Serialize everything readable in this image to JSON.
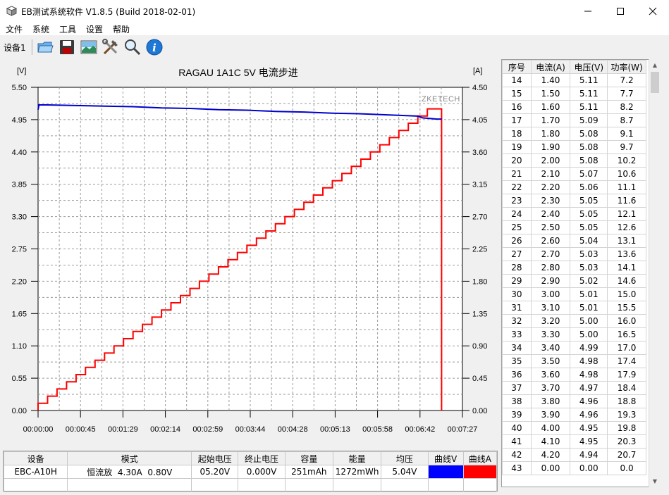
{
  "window": {
    "title": "EB测试系统软件 V1.8.5 (Build 2018-02-01)",
    "minimize_icon": "minimize-icon",
    "maximize_icon": "maximize-icon",
    "close_icon": "close-icon"
  },
  "menu": {
    "items": [
      "文件",
      "系统",
      "工具",
      "设置",
      "帮助"
    ]
  },
  "toolbar": {
    "device_tab": "设备1",
    "buttons": [
      "folder-open-icon",
      "save-icon",
      "chart-image-icon",
      "tools-icon",
      "zoom-icon",
      "info-icon"
    ]
  },
  "chart": {
    "brand": "ZKETECH",
    "colors": {
      "voltage": "#0000cc",
      "current": "#ff0000"
    }
  },
  "chart_data": {
    "type": "line",
    "title": "RAGAU 1A1C 5V 电流步进",
    "ylabel_left": "[V]",
    "ylabel_right": "[A]",
    "left_ticks": [
      "5.50",
      "4.95",
      "4.40",
      "3.85",
      "3.30",
      "2.75",
      "2.20",
      "1.65",
      "1.10",
      "0.55",
      "0.00"
    ],
    "right_ticks": [
      "4.50",
      "4.05",
      "3.60",
      "3.15",
      "2.70",
      "2.25",
      "1.80",
      "1.35",
      "0.90",
      "0.45",
      "0.00"
    ],
    "x_ticks": [
      "00:00:00",
      "00:00:45",
      "00:01:29",
      "00:02:14",
      "00:02:59",
      "00:03:44",
      "00:04:28",
      "00:05:13",
      "00:05:58",
      "00:06:42",
      "00:07:27"
    ],
    "ylim_left": [
      0,
      5.5
    ],
    "ylim_right": [
      0,
      4.5
    ],
    "xlim_seconds": [
      0,
      447
    ],
    "grid": true,
    "series": [
      {
        "name": "曲线V",
        "axis": "left",
        "x": [
          0,
          1,
          10,
          40,
          70,
          100,
          130,
          160,
          190,
          220,
          250,
          280,
          310,
          340,
          370,
          400,
          405,
          420,
          425
        ],
        "y": [
          5.12,
          5.2,
          5.2,
          5.19,
          5.18,
          5.17,
          5.15,
          5.14,
          5.12,
          5.11,
          5.09,
          5.08,
          5.06,
          5.05,
          5.03,
          5.01,
          4.98,
          4.96,
          4.96
        ]
      },
      {
        "name": "曲线A",
        "axis": "right",
        "steps_start": 0.1,
        "steps_increment": 0.1,
        "steps_count": 42,
        "step_seconds": 10,
        "end_seconds": 425
      }
    ]
  },
  "summary_table": {
    "headers": [
      "设备",
      "模式",
      "起始电压",
      "终止电压",
      "容量",
      "能量",
      "均压",
      "曲线V",
      "曲线A"
    ],
    "row": [
      "EBC-A10H",
      "恒流放  4.30A  0.80V",
      "05.20V",
      "0.000V",
      "251mAh",
      "1272mWh",
      "5.04V",
      "",
      ""
    ],
    "color_v": "#0000ff",
    "color_a": "#ff0000"
  },
  "step_table": {
    "headers": [
      "序号",
      "电流(A)",
      "电压(V)",
      "功率(W)"
    ],
    "rows": [
      [
        "14",
        "1.40",
        "5.11",
        "7.2"
      ],
      [
        "15",
        "1.50",
        "5.11",
        "7.7"
      ],
      [
        "16",
        "1.60",
        "5.11",
        "8.2"
      ],
      [
        "17",
        "1.70",
        "5.09",
        "8.7"
      ],
      [
        "18",
        "1.80",
        "5.08",
        "9.1"
      ],
      [
        "19",
        "1.90",
        "5.08",
        "9.7"
      ],
      [
        "20",
        "2.00",
        "5.08",
        "10.2"
      ],
      [
        "21",
        "2.10",
        "5.07",
        "10.6"
      ],
      [
        "22",
        "2.20",
        "5.06",
        "11.1"
      ],
      [
        "23",
        "2.30",
        "5.05",
        "11.6"
      ],
      [
        "24",
        "2.40",
        "5.05",
        "12.1"
      ],
      [
        "25",
        "2.50",
        "5.05",
        "12.6"
      ],
      [
        "26",
        "2.60",
        "5.04",
        "13.1"
      ],
      [
        "27",
        "2.70",
        "5.03",
        "13.6"
      ],
      [
        "28",
        "2.80",
        "5.03",
        "14.1"
      ],
      [
        "29",
        "2.90",
        "5.02",
        "14.6"
      ],
      [
        "30",
        "3.00",
        "5.01",
        "15.0"
      ],
      [
        "31",
        "3.10",
        "5.01",
        "15.5"
      ],
      [
        "32",
        "3.20",
        "5.00",
        "16.0"
      ],
      [
        "33",
        "3.30",
        "5.00",
        "16.5"
      ],
      [
        "34",
        "3.40",
        "4.99",
        "17.0"
      ],
      [
        "35",
        "3.50",
        "4.98",
        "17.4"
      ],
      [
        "36",
        "3.60",
        "4.98",
        "17.9"
      ],
      [
        "37",
        "3.70",
        "4.97",
        "18.4"
      ],
      [
        "38",
        "3.80",
        "4.96",
        "18.8"
      ],
      [
        "39",
        "3.90",
        "4.96",
        "19.3"
      ],
      [
        "40",
        "4.00",
        "4.95",
        "19.8"
      ],
      [
        "41",
        "4.10",
        "4.95",
        "20.3"
      ],
      [
        "42",
        "4.20",
        "4.94",
        "20.7"
      ],
      [
        "43",
        "0.00",
        "0.00",
        "0.0"
      ]
    ]
  }
}
